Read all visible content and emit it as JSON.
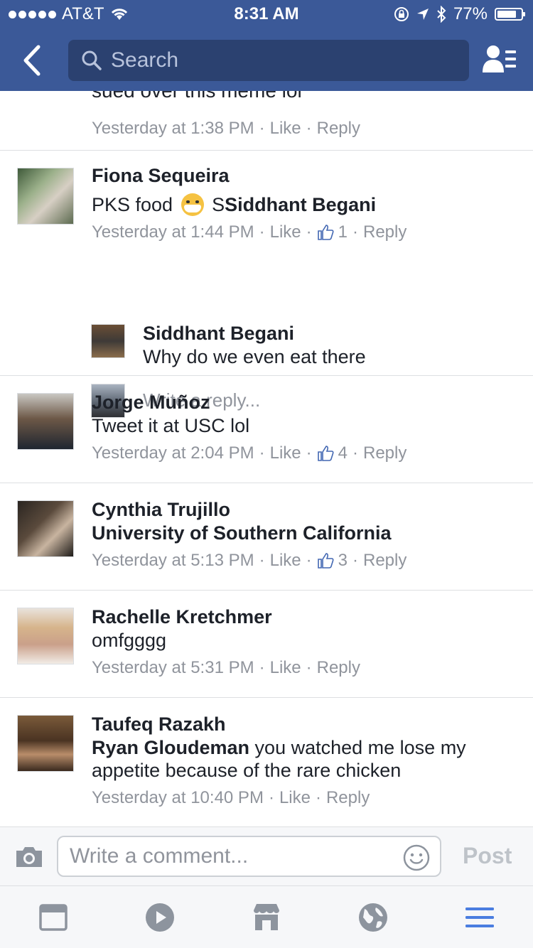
{
  "status_bar": {
    "carrier": "AT&T",
    "time": "8:31 AM",
    "battery": "77%"
  },
  "header": {
    "search_placeholder": "Search"
  },
  "partial_comment": {
    "text": "sued over this meme lol",
    "time": "Yesterday at 1:38 PM",
    "like": "Like",
    "reply": "Reply"
  },
  "comments": [
    {
      "name": "Fiona Sequeira",
      "text_prefix": "PKS food",
      "text_after_emoji_plain": "S",
      "text_mention": "Siddhant Begani",
      "time": "Yesterday at 1:44 PM",
      "like": "Like",
      "likes_count": "1",
      "reply": "Reply",
      "replies": [
        {
          "name": "Siddhant Begani",
          "text": "Why do we even eat there"
        }
      ],
      "write_reply_placeholder": "Write a reply..."
    },
    {
      "name": "Jorge Muñoz",
      "text": "Tweet it at USC lol",
      "time": "Yesterday at 2:04 PM",
      "like": "Like",
      "likes_count": "4",
      "reply": "Reply"
    },
    {
      "name": "Cynthia Trujillo",
      "text_mention": "University of Southern California",
      "time": "Yesterday at 5:13 PM",
      "like": "Like",
      "likes_count": "3",
      "reply": "Reply"
    },
    {
      "name": "Rachelle Kretchmer",
      "text": "omfgggg",
      "time": "Yesterday at 5:31 PM",
      "like": "Like",
      "reply": "Reply"
    },
    {
      "name": "Taufeq Razakh",
      "text_mention": "Ryan Gloudeman",
      "text": " you watched me lose my appetite because of the rare chicken",
      "time": "Yesterday at 10:40 PM",
      "like": "Like",
      "reply": "Reply"
    }
  ],
  "composer": {
    "placeholder": "Write a comment...",
    "post_label": "Post"
  },
  "colors": {
    "brand_blue": "#3b5998",
    "meta_gray": "#90949c",
    "active_nav": "#4a7de0"
  },
  "icons": {
    "header": [
      "back-chevron-icon",
      "search-icon",
      "friends-icon"
    ],
    "nav": [
      "news-feed-icon",
      "video-icon",
      "marketplace-icon",
      "notifications-globe-icon",
      "menu-icon"
    ]
  }
}
